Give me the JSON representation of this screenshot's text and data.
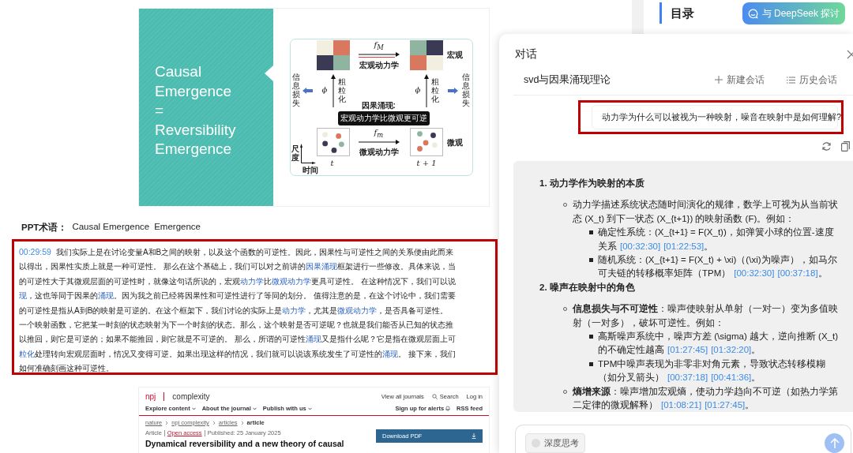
{
  "slide": {
    "title_lines": [
      "Causal",
      "Emergence",
      "=",
      "Reversibility",
      "Emergence"
    ],
    "diagram": {
      "macro_label": "宏观",
      "micro_label": "微观",
      "macro_map": "*f*$_{M}$",
      "macro_dynamics": "宏观动力学",
      "micro_map": "*f*$_{m}$",
      "micro_dynamics": "微观动力学",
      "coarse_symbols": [
        "ϕ",
        "ϕ"
      ],
      "coarse_labels": [
        "粗粒化",
        "粗粒化"
      ],
      "loss_labels": [
        "信息损失",
        "信息损失"
      ],
      "emergence_title": "因果涌现:",
      "emergence_note": "宏观动力学比微观更可逆",
      "time_labels": [
        "t",
        "t + 1"
      ],
      "axis_y": "尺度",
      "axis_x": "时间"
    }
  },
  "terms": {
    "label": "PPT术语：",
    "items": [
      "Causal Emergence",
      "Emergence"
    ]
  },
  "transcript": {
    "lines": [
      [
        {
          "kind": "time",
          "text": "00:29:59"
        },
        {
          "kind": "text",
          "text": "我们实际上是在讨论变量A和B之间的映射，以及这个函数的可逆性。因此，因果性与可逆性之间的关系便由此而来"
        }
      ],
      [
        {
          "kind": "text",
          "text": "以得出，因果性实质上就是一种可逆性。 那么在这个基础上，我们可以对之前讲的"
        },
        {
          "kind": "term",
          "text": "因果涌现"
        },
        {
          "kind": "text",
          "text": "框架进行一些修改。具体来说，当"
        }
      ],
      [
        {
          "kind": "text",
          "text": "的可逆性大于其微观层面的可逆性时，就像这句话所说的，宏观"
        },
        {
          "kind": "term",
          "text": "动力学"
        },
        {
          "kind": "text",
          "text": "比"
        },
        {
          "kind": "term",
          "text": "微观动力学"
        },
        {
          "kind": "text",
          "text": "更具可逆性。 在这种情况下，我们可以说"
        }
      ],
      [
        {
          "kind": "term",
          "text": "现"
        },
        {
          "kind": "text",
          "text": "，这也等同于因果的"
        },
        {
          "kind": "term",
          "text": "涌现"
        },
        {
          "kind": "text",
          "text": "。因为我之前已经将因果性和可逆性进行了等同的划分。 值得注意的是，在这个讨论中，我们需要"
        }
      ],
      [
        {
          "kind": "text",
          "text": "的可逆性是指从A到B的映射是可逆的。在这个框架下，我们讨论的实际上是"
        },
        {
          "kind": "term",
          "text": "动力学"
        },
        {
          "kind": "text",
          "text": "，尤其是"
        },
        {
          "kind": "term",
          "text": "微观动力学"
        },
        {
          "kind": "text",
          "text": "，是否具备可逆性。"
        }
      ],
      [
        {
          "kind": "text",
          "text": "一个映射函数，它把某一时刻的状态映射为下一个时刻的状态。那么，这个映射是否可逆呢？也就是我们能否从已知的状态推"
        }
      ],
      [
        {
          "kind": "text",
          "text": "以推回，则它是可逆的；如果不能推回，则它就是不可逆的。 那么，所谓的可逆性"
        },
        {
          "kind": "term",
          "text": "涌现"
        },
        {
          "kind": "text",
          "text": "又是指什么呢？它是指在微观层面上可"
        }
      ],
      [
        {
          "kind": "term",
          "text": "粒化"
        },
        {
          "kind": "text",
          "text": "处理转向宏观层面时，情况又变得可逆。如果出现这样的情况，我们就可以说该系统发生了可逆性的"
        },
        {
          "kind": "term",
          "text": "涌现"
        },
        {
          "kind": "text",
          "text": "。 接下来，我们"
        }
      ],
      [
        {
          "kind": "text",
          "text": "如何准确刻画这种可逆性。"
        }
      ]
    ]
  },
  "article": {
    "brand": "npj",
    "journal": "complexity",
    "top_links": [
      "View all journals",
      "Search",
      "Log in"
    ],
    "nav": [
      "Explore content",
      "About the journal",
      "Publish with us"
    ],
    "alerts": "Sign up for alerts",
    "rss": "RSS feed",
    "breadcrumb": [
      "nature",
      "npj complexity",
      "articles",
      "article"
    ],
    "meta": [
      "Article",
      "Open access",
      "Published: 25 January 2025"
    ],
    "title": "Dynamical reversibility and a new theory of causal",
    "download": "Download PDF"
  },
  "sidebar": {
    "heading": "目录",
    "discuss_button": "与 DeepSeek 探讨"
  },
  "chat": {
    "title": "对话",
    "session": "svd与因果涌现理论",
    "actions": [
      "新建会话",
      "历史会话"
    ],
    "question": "动力学为什么可以被视为一种映射，噪音在映射中是如何理解?",
    "answer": [
      {
        "number": "1.",
        "title": "动力学作为映射的本质",
        "items": [
          {
            "text": "动力学描述系统状态随时间演化的规律，数学上可视为从当前状态 (X_t) 到下一状态 (X_{t+1}) 的映射函数 (F)。例如：",
            "children": [
              {
                "text": "确定性系统：(X_{t+1} = F(X_t))，如弹簧小球的位置-速度关系",
                "refs": [
                  "[00:32:30]",
                  "[01:22:53]"
                ],
                "end": "。"
              },
              {
                "text": "随机系统：(X_{t+1} = F(X_t) + \\xi)（(\\xi)为噪声），如马尔可夫链的转移概率矩阵（TPM）",
                "refs": [
                  "[00:32:30]",
                  "[00:37:18]"
                ],
                "end": "。"
              }
            ]
          }
        ]
      },
      {
        "number": "2.",
        "title": "噪声在映射中的角色",
        "items": [
          {
            "lead": "信息损失与不可逆性",
            "text": "：噪声使映射从单射（一对一）变为多值映射（一对多），破坏可逆性。例如：",
            "children": [
              {
                "text": "高斯噪声系统中，噪声方差 (\\sigma) 越大，逆向推断 (X_t) 的不确定性越高",
                "refs": [
                  "[01:27:45]",
                  "[01:32:20]"
                ],
                "end": "。"
              },
              {
                "text": "TPM中噪声表现为非零非对角元素，导致状态转移模糊（如分叉箭头）",
                "refs": [
                  "[00:37:18]",
                  "[00:41:36]"
                ],
                "end": "。"
              }
            ]
          },
          {
            "lead": "熵增来源",
            "text": "：噪声增加宏观熵，使动力学趋向不可逆（如热力学第二定律的微观解释）",
            "refs": [
              "[01:08:21]",
              "[01:27:45]"
            ],
            "end": "。"
          }
        ]
      }
    ],
    "deep_think": {
      "label": "深度思考",
      "on": false
    }
  }
}
